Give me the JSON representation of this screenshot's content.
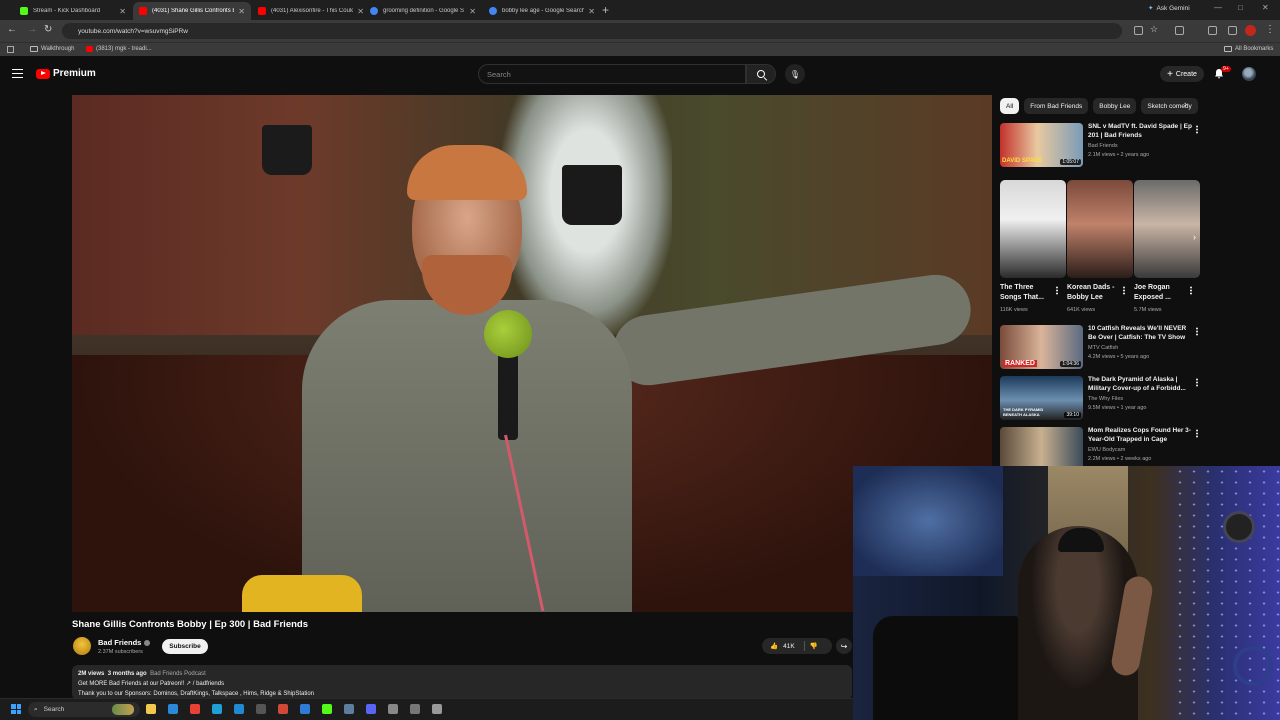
{
  "browser": {
    "tabs": [
      {
        "title": "Stream - Kick Dashboard",
        "favicon_color": "#53fc18",
        "active": false
      },
      {
        "title": "(4031) Shane Gillis Confronts Bobby",
        "favicon_color": "#ff0000",
        "active": true
      },
      {
        "title": "(4031) Alexisonfire - This Could",
        "favicon_color": "#ff0000",
        "active": false
      },
      {
        "title": "grooming definition - Google S",
        "favicon_color": "#4285f4",
        "active": false
      },
      {
        "title": "bobby lee age - Google Search",
        "favicon_color": "#4285f4",
        "active": false
      }
    ],
    "new_tab_icon": "plus-icon",
    "ask_gemini": "Ask Gemini",
    "url": "youtube.com/watch?v=wsuvmgSiPRw",
    "bookmarks": [
      {
        "label": "Walkthrough",
        "icon": "folder-icon"
      },
      {
        "label": "(3813) mgk - treadi...",
        "icon": "youtube-icon"
      }
    ],
    "all_bookmarks": "All Bookmarks"
  },
  "youtube": {
    "logo_text": "Premium",
    "brand_color": "#ff0000",
    "search_placeholder": "Search",
    "create_label": "Create",
    "notification_badge": "9+"
  },
  "video": {
    "title": "Shane Gillis Confronts Bobby | Ep 300 | Bad Friends",
    "channel": "Bad Friends",
    "subscribers": "2.37M subscribers",
    "subscribe_label": "Subscribe",
    "likes": "41K",
    "description": {
      "views": "2M views",
      "age": "3 months ago",
      "tag": "Bad Friends Podcast",
      "line1": "Get MORE Bad Friends at our Patreon!! ↗ / badfriends",
      "line2": "Thank you to our Sponsors: Dominos, DraftKings, Talkspace , Hims, Ridge & ShipStation"
    }
  },
  "sidebar": {
    "chips": [
      "All",
      "From Bad Friends",
      "Bobby Lee",
      "Sketch comedy"
    ],
    "recommendations_top": [
      {
        "title": "SNL v MadTV ft. David Spade | Ep 201 | Bad Friends",
        "channel": "Bad Friends",
        "meta": "2.1M views • 2 years ago",
        "duration": "1:05:07",
        "thumb_caption": "DAVID SPADE"
      }
    ],
    "shorts": [
      {
        "title": "The Three Songs That...",
        "views": "116K views"
      },
      {
        "title": "Korean Dads - Bobby Lee",
        "views": "641K views"
      },
      {
        "title": "Joe Rogan Exposed ...",
        "views": "5.7M views"
      }
    ],
    "recommendations": [
      {
        "title": "10 Catfish Reveals We'll NEVER Be Over | Catfish: The TV Show",
        "channel": "MTV Catfish",
        "meta": "4.2M views • 5 years ago",
        "duration": "1:04:36",
        "thumb_caption": "RANKED"
      },
      {
        "title": "The Dark Pyramid of Alaska | Military Cover-up of a Forbidd...",
        "channel": "The Why Files",
        "meta": "9.5M views • 1 year ago",
        "duration": "39:10",
        "thumb_caption": "THE DARK PYRAMID BENEATH ALASKA"
      },
      {
        "title": "Mom Realizes Cops Found Her 3-Year-Old Trapped in Cage",
        "channel": "EWU Bodycam",
        "meta": "2.2M views • 2 weeks ago",
        "duration": "",
        "thumb_caption": ""
      }
    ]
  },
  "taskbar": {
    "search_label": "Search",
    "apps": [
      {
        "icon": "explorer-icon",
        "color": "#f2c94c"
      },
      {
        "icon": "store-icon",
        "color": "#2b88d8"
      },
      {
        "icon": "chrome-icon",
        "color": "#e94235"
      },
      {
        "icon": "edge-icon",
        "color": "#1ea0d6"
      },
      {
        "icon": "vscode-icon",
        "color": "#1f8ad2"
      },
      {
        "icon": "terminal-icon",
        "color": "#555555"
      },
      {
        "icon": "app-icon",
        "color": "#d14836"
      },
      {
        "icon": "app-icon",
        "color": "#2f7bd8"
      },
      {
        "icon": "kick-icon",
        "color": "#53fc18"
      },
      {
        "icon": "steam-icon",
        "color": "#5c7e9c"
      },
      {
        "icon": "discord-icon",
        "color": "#5865f2"
      },
      {
        "icon": "obs-icon",
        "color": "#888888"
      },
      {
        "icon": "app-icon",
        "color": "#777777"
      },
      {
        "icon": "settings-icon",
        "color": "#999999"
      }
    ]
  }
}
